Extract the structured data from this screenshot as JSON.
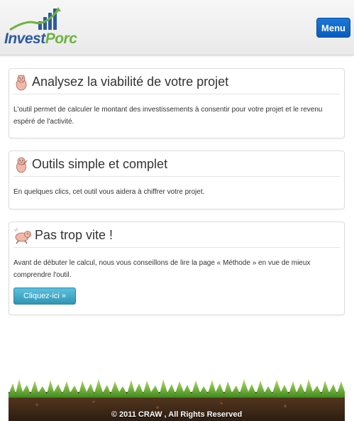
{
  "header": {
    "logo": {
      "part1": "Invest",
      "part2": "Porc"
    },
    "menu_label": "Menu"
  },
  "panels": [
    {
      "icon": "pig-icon",
      "title": "Analysez la viabilité de votre projet",
      "text": "L'outil permet de calculer le montant des investissements à consentir pour votre projet et le revenu espéré de l'activité."
    },
    {
      "icon": "pig-icon",
      "title": "Outils simple et complet",
      "text": "En quelques clics, cet outil vous aidera à chiffrer votre projet."
    },
    {
      "icon": "running-pig-icon",
      "title": "Pas trop vite !",
      "text": "Avant de débuter le calcul, nous vous conseillons de lire la page « Méthode » en vue de mieux comprendre l'outil.",
      "button_label": "Cliquez-ici »"
    }
  ],
  "footer": {
    "copyright": "© 2011 CRAW , All Rights Reserved"
  },
  "colors": {
    "menu_button": "#0b5cc0",
    "cta_button": "#2f96b4",
    "logo_blue": "#2d5aa0",
    "logo_green": "#6cb33f"
  }
}
